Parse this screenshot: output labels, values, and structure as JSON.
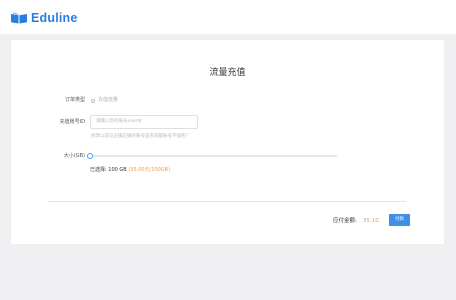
{
  "brand": {
    "name": "Eduline",
    "accent_color": "#2b7de0"
  },
  "page": {
    "title": "流量充值"
  },
  "form": {
    "order_type_label": "订单类型",
    "order_type_option": "充值流量",
    "account_label": "充值账号ID",
    "account_placeholder": "请输入您的账号userId",
    "account_hint": "修改以前与正确正确的账号是否成都账号不加密?",
    "size_label": "大小(GB)",
    "size_slider_fraction": 0.0,
    "selected_prefix": "已选择: 100 GB",
    "selected_price": "(35.00元/100GB)"
  },
  "footer": {
    "pay_label": "应付金额:",
    "pay_amount": "35.10",
    "pay_button": "付款",
    "price_color": "#f29a4a",
    "button_color": "#3d8fe8"
  }
}
